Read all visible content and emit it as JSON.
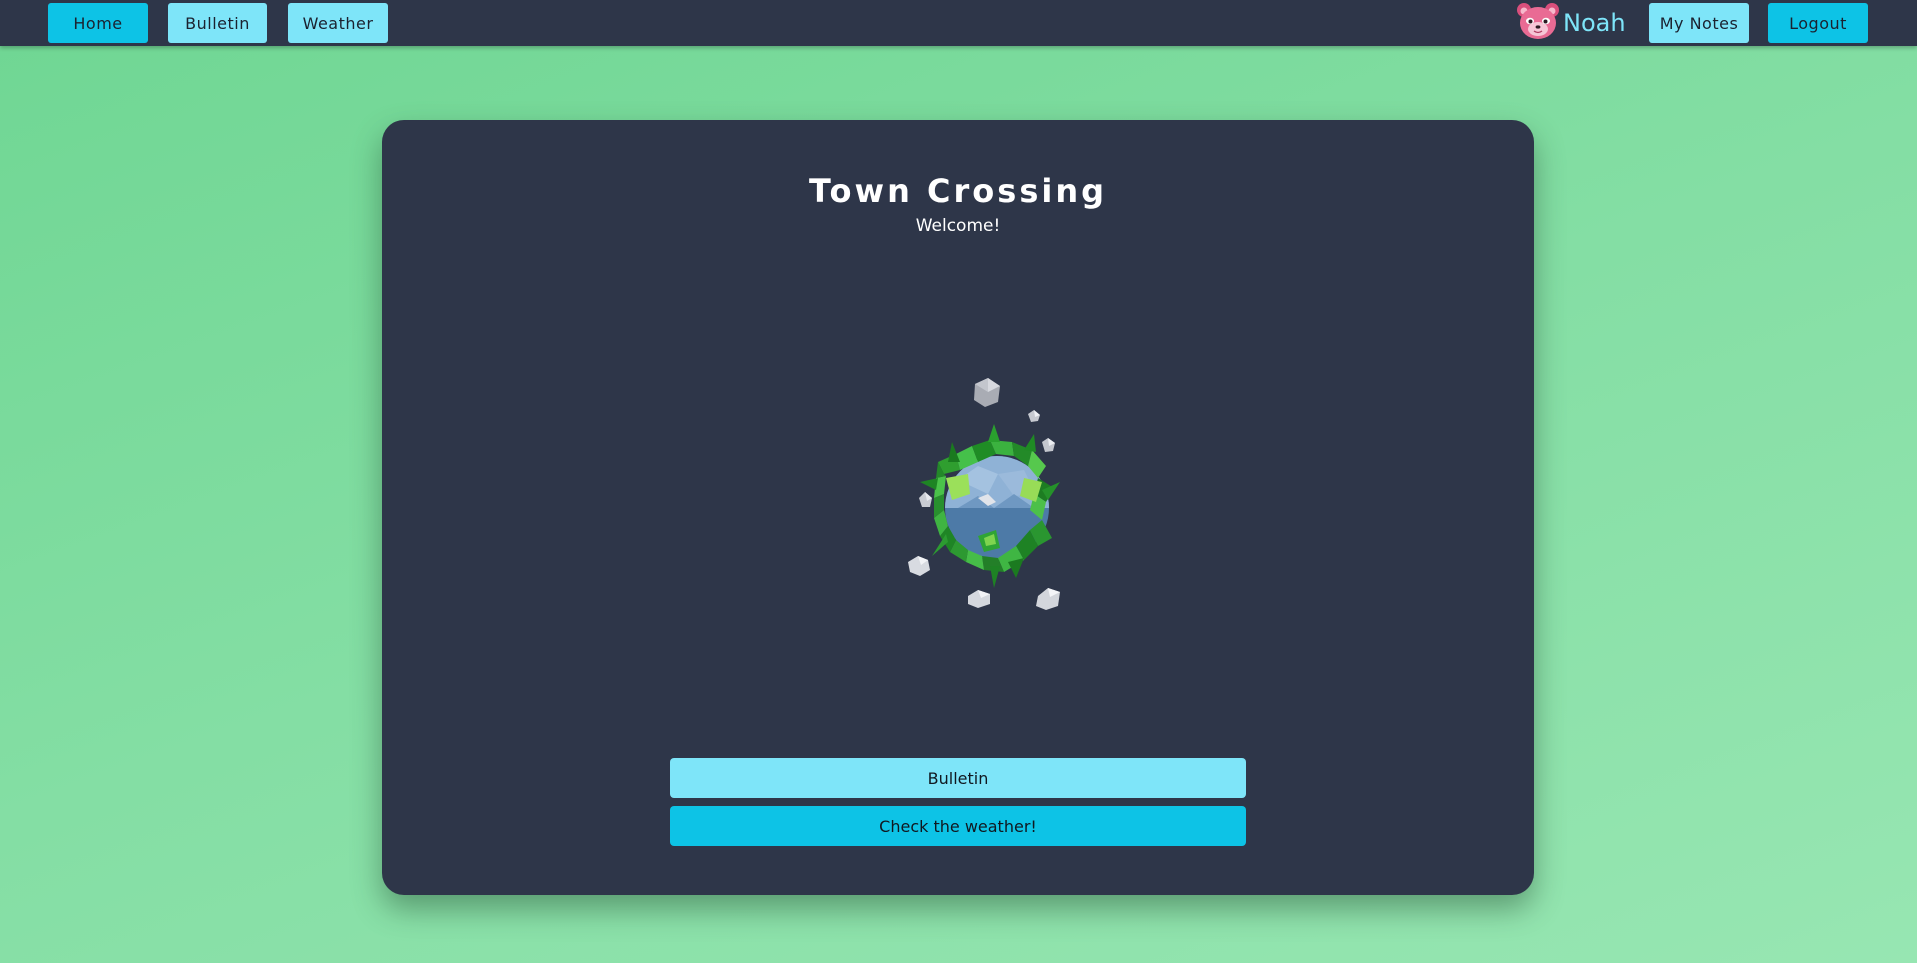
{
  "nav": {
    "home_label": "Home",
    "bulletin_label": "Bulletin",
    "weather_label": "Weather",
    "user_name": "Noah",
    "user_icon": "red-panda-avatar-icon",
    "my_notes_label": "My Notes",
    "logout_label": "Logout"
  },
  "main": {
    "title": "Town Crossing",
    "subtitle": "Welcome!",
    "illustration": "low-poly-planet-icon",
    "bulletin_button": "Bulletin",
    "weather_button": "Check the weather!"
  },
  "colors": {
    "background": "#7fdc9f",
    "panel": "#2e3649",
    "accent_dark_cyan": "#0dc3e6",
    "accent_light_cyan": "#7ee5f9"
  }
}
